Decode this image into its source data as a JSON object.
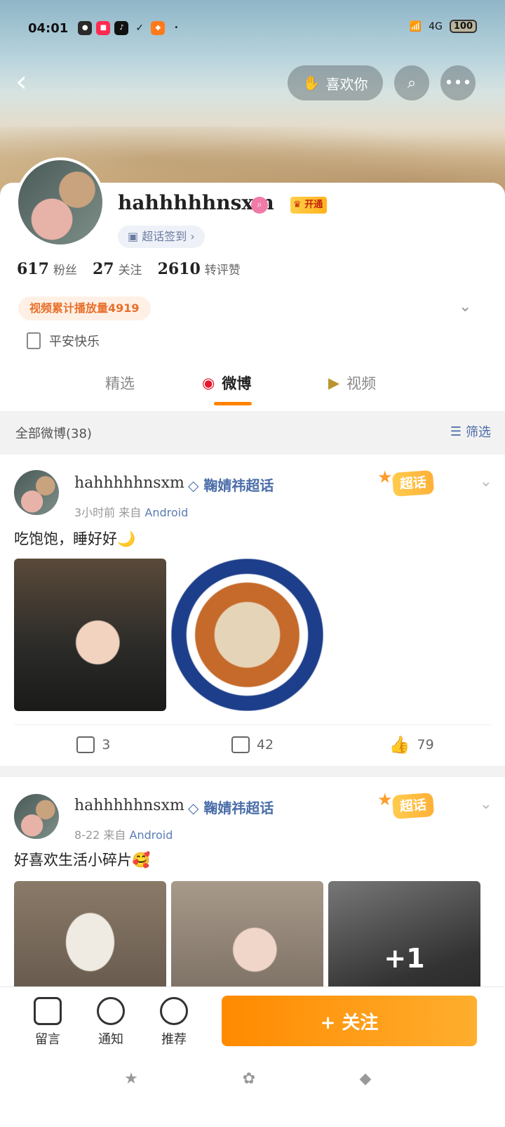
{
  "status_bar": {
    "time": "04:01",
    "battery": "100",
    "network": "4G",
    "app_icons": [
      "wechat-icon",
      "xiaohongshu-icon",
      "douyin-icon",
      "check-icon",
      "app-icon"
    ]
  },
  "header": {
    "like_label": "喜欢你"
  },
  "profile": {
    "username": "hahhhhhnsxm",
    "vip_label": "开通",
    "checkin_label": "超话签到",
    "stats": [
      {
        "num": "617",
        "label": "粉丝"
      },
      {
        "num": "27",
        "label": "关注"
      },
      {
        "num": "2610",
        "label": "转评赞"
      }
    ],
    "play_count": "视频累计播放量4919",
    "bio": "平安快乐"
  },
  "tabs": [
    {
      "label": "精选"
    },
    {
      "label": "微博"
    },
    {
      "label": "视频"
    }
  ],
  "filter": {
    "label": "全部微博(38)",
    "filter_label": "筛选"
  },
  "posts": [
    {
      "name": "hahhhhhnsxm",
      "topic": "鞠婧祎超话",
      "time": "3小时前",
      "from_prefix": "来自",
      "source": "Android",
      "chaohua": "超话",
      "text": "吃饱饱，睡好好🌙",
      "reposts": "3",
      "comments": "42",
      "likes": "79"
    },
    {
      "name": "hahhhhhnsxm",
      "topic": "鞠婧祎超话",
      "time": "8-22",
      "from_prefix": "来自",
      "source": "Android",
      "chaohua": "超话",
      "text": "好喜欢生活小碎片🥰",
      "extra_images": "+1"
    }
  ],
  "bottom_bar": {
    "message": "留言",
    "notify": "通知",
    "recommend": "推荐",
    "follow": "+ 关注"
  },
  "colors": {
    "accent": "#ff8200",
    "link": "#4b6ea8"
  }
}
